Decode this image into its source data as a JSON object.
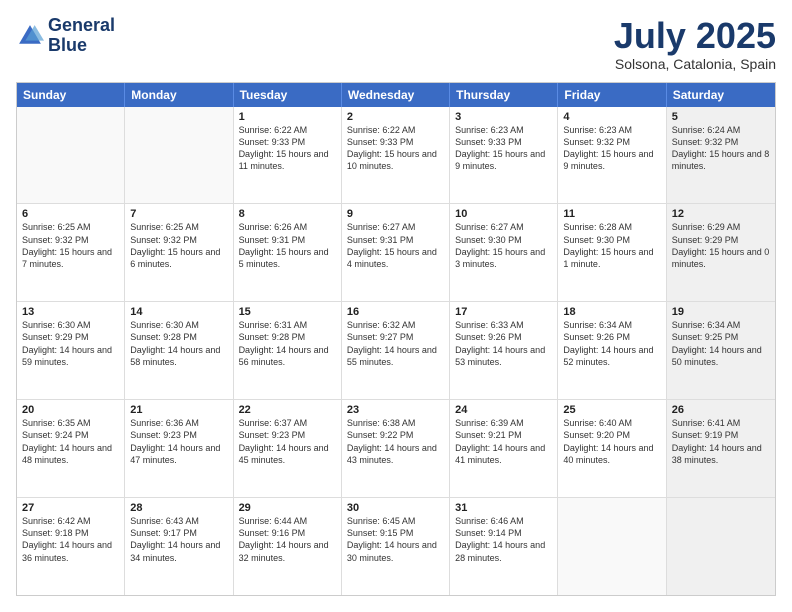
{
  "logo": {
    "line1": "General",
    "line2": "Blue"
  },
  "title": "July 2025",
  "location": "Solsona, Catalonia, Spain",
  "weekdays": [
    "Sunday",
    "Monday",
    "Tuesday",
    "Wednesday",
    "Thursday",
    "Friday",
    "Saturday"
  ],
  "weeks": [
    [
      {
        "day": "",
        "sunrise": "",
        "sunset": "",
        "daylight": "",
        "shaded": false
      },
      {
        "day": "",
        "sunrise": "",
        "sunset": "",
        "daylight": "",
        "shaded": false
      },
      {
        "day": "1",
        "sunrise": "Sunrise: 6:22 AM",
        "sunset": "Sunset: 9:33 PM",
        "daylight": "Daylight: 15 hours and 11 minutes.",
        "shaded": false
      },
      {
        "day": "2",
        "sunrise": "Sunrise: 6:22 AM",
        "sunset": "Sunset: 9:33 PM",
        "daylight": "Daylight: 15 hours and 10 minutes.",
        "shaded": false
      },
      {
        "day": "3",
        "sunrise": "Sunrise: 6:23 AM",
        "sunset": "Sunset: 9:33 PM",
        "daylight": "Daylight: 15 hours and 9 minutes.",
        "shaded": false
      },
      {
        "day": "4",
        "sunrise": "Sunrise: 6:23 AM",
        "sunset": "Sunset: 9:32 PM",
        "daylight": "Daylight: 15 hours and 9 minutes.",
        "shaded": false
      },
      {
        "day": "5",
        "sunrise": "Sunrise: 6:24 AM",
        "sunset": "Sunset: 9:32 PM",
        "daylight": "Daylight: 15 hours and 8 minutes.",
        "shaded": true
      }
    ],
    [
      {
        "day": "6",
        "sunrise": "Sunrise: 6:25 AM",
        "sunset": "Sunset: 9:32 PM",
        "daylight": "Daylight: 15 hours and 7 minutes.",
        "shaded": false
      },
      {
        "day": "7",
        "sunrise": "Sunrise: 6:25 AM",
        "sunset": "Sunset: 9:32 PM",
        "daylight": "Daylight: 15 hours and 6 minutes.",
        "shaded": false
      },
      {
        "day": "8",
        "sunrise": "Sunrise: 6:26 AM",
        "sunset": "Sunset: 9:31 PM",
        "daylight": "Daylight: 15 hours and 5 minutes.",
        "shaded": false
      },
      {
        "day": "9",
        "sunrise": "Sunrise: 6:27 AM",
        "sunset": "Sunset: 9:31 PM",
        "daylight": "Daylight: 15 hours and 4 minutes.",
        "shaded": false
      },
      {
        "day": "10",
        "sunrise": "Sunrise: 6:27 AM",
        "sunset": "Sunset: 9:30 PM",
        "daylight": "Daylight: 15 hours and 3 minutes.",
        "shaded": false
      },
      {
        "day": "11",
        "sunrise": "Sunrise: 6:28 AM",
        "sunset": "Sunset: 9:30 PM",
        "daylight": "Daylight: 15 hours and 1 minute.",
        "shaded": false
      },
      {
        "day": "12",
        "sunrise": "Sunrise: 6:29 AM",
        "sunset": "Sunset: 9:29 PM",
        "daylight": "Daylight: 15 hours and 0 minutes.",
        "shaded": true
      }
    ],
    [
      {
        "day": "13",
        "sunrise": "Sunrise: 6:30 AM",
        "sunset": "Sunset: 9:29 PM",
        "daylight": "Daylight: 14 hours and 59 minutes.",
        "shaded": false
      },
      {
        "day": "14",
        "sunrise": "Sunrise: 6:30 AM",
        "sunset": "Sunset: 9:28 PM",
        "daylight": "Daylight: 14 hours and 58 minutes.",
        "shaded": false
      },
      {
        "day": "15",
        "sunrise": "Sunrise: 6:31 AM",
        "sunset": "Sunset: 9:28 PM",
        "daylight": "Daylight: 14 hours and 56 minutes.",
        "shaded": false
      },
      {
        "day": "16",
        "sunrise": "Sunrise: 6:32 AM",
        "sunset": "Sunset: 9:27 PM",
        "daylight": "Daylight: 14 hours and 55 minutes.",
        "shaded": false
      },
      {
        "day": "17",
        "sunrise": "Sunrise: 6:33 AM",
        "sunset": "Sunset: 9:26 PM",
        "daylight": "Daylight: 14 hours and 53 minutes.",
        "shaded": false
      },
      {
        "day": "18",
        "sunrise": "Sunrise: 6:34 AM",
        "sunset": "Sunset: 9:26 PM",
        "daylight": "Daylight: 14 hours and 52 minutes.",
        "shaded": false
      },
      {
        "day": "19",
        "sunrise": "Sunrise: 6:34 AM",
        "sunset": "Sunset: 9:25 PM",
        "daylight": "Daylight: 14 hours and 50 minutes.",
        "shaded": true
      }
    ],
    [
      {
        "day": "20",
        "sunrise": "Sunrise: 6:35 AM",
        "sunset": "Sunset: 9:24 PM",
        "daylight": "Daylight: 14 hours and 48 minutes.",
        "shaded": false
      },
      {
        "day": "21",
        "sunrise": "Sunrise: 6:36 AM",
        "sunset": "Sunset: 9:23 PM",
        "daylight": "Daylight: 14 hours and 47 minutes.",
        "shaded": false
      },
      {
        "day": "22",
        "sunrise": "Sunrise: 6:37 AM",
        "sunset": "Sunset: 9:23 PM",
        "daylight": "Daylight: 14 hours and 45 minutes.",
        "shaded": false
      },
      {
        "day": "23",
        "sunrise": "Sunrise: 6:38 AM",
        "sunset": "Sunset: 9:22 PM",
        "daylight": "Daylight: 14 hours and 43 minutes.",
        "shaded": false
      },
      {
        "day": "24",
        "sunrise": "Sunrise: 6:39 AM",
        "sunset": "Sunset: 9:21 PM",
        "daylight": "Daylight: 14 hours and 41 minutes.",
        "shaded": false
      },
      {
        "day": "25",
        "sunrise": "Sunrise: 6:40 AM",
        "sunset": "Sunset: 9:20 PM",
        "daylight": "Daylight: 14 hours and 40 minutes.",
        "shaded": false
      },
      {
        "day": "26",
        "sunrise": "Sunrise: 6:41 AM",
        "sunset": "Sunset: 9:19 PM",
        "daylight": "Daylight: 14 hours and 38 minutes.",
        "shaded": true
      }
    ],
    [
      {
        "day": "27",
        "sunrise": "Sunrise: 6:42 AM",
        "sunset": "Sunset: 9:18 PM",
        "daylight": "Daylight: 14 hours and 36 minutes.",
        "shaded": false
      },
      {
        "day": "28",
        "sunrise": "Sunrise: 6:43 AM",
        "sunset": "Sunset: 9:17 PM",
        "daylight": "Daylight: 14 hours and 34 minutes.",
        "shaded": false
      },
      {
        "day": "29",
        "sunrise": "Sunrise: 6:44 AM",
        "sunset": "Sunset: 9:16 PM",
        "daylight": "Daylight: 14 hours and 32 minutes.",
        "shaded": false
      },
      {
        "day": "30",
        "sunrise": "Sunrise: 6:45 AM",
        "sunset": "Sunset: 9:15 PM",
        "daylight": "Daylight: 14 hours and 30 minutes.",
        "shaded": false
      },
      {
        "day": "31",
        "sunrise": "Sunrise: 6:46 AM",
        "sunset": "Sunset: 9:14 PM",
        "daylight": "Daylight: 14 hours and 28 minutes.",
        "shaded": false
      },
      {
        "day": "",
        "sunrise": "",
        "sunset": "",
        "daylight": "",
        "shaded": false
      },
      {
        "day": "",
        "sunrise": "",
        "sunset": "",
        "daylight": "",
        "shaded": true
      }
    ]
  ]
}
